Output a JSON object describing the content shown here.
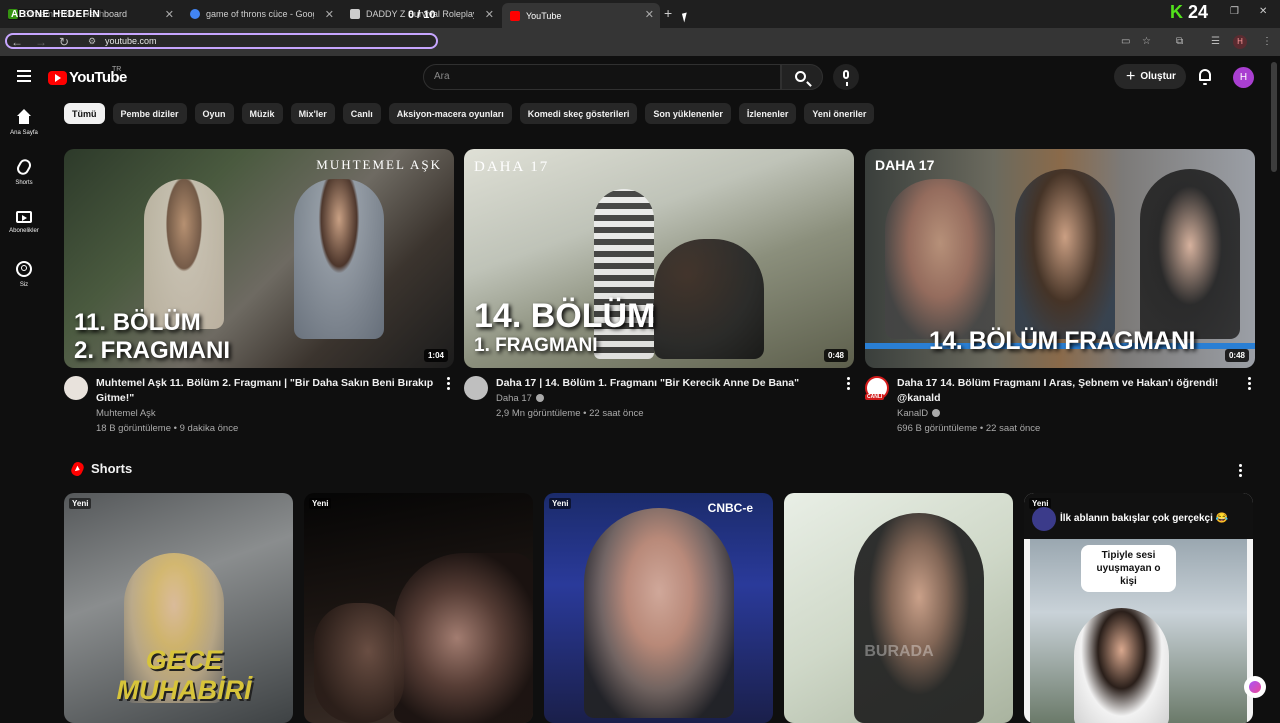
{
  "browser": {
    "tabs": [
      {
        "label": "Streamer Kick Dashboard",
        "fav_color": "#52e21b"
      },
      {
        "label": "game of throns cüce - Google'da Ara",
        "fav_color": "#4285f4"
      },
      {
        "label": "DADDY Z Survival Roleplay Ser",
        "fav_color": "#cccccc"
      },
      {
        "label": "YouTube",
        "fav_color": "#ff0000"
      }
    ],
    "new_tab_symbol": "+",
    "url": "youtube.com",
    "profile_letter": "H"
  },
  "overlay": {
    "abone_label": "ABONE HEDEFİN",
    "abone_count": "0 / 10",
    "kick_k": "K",
    "kick_num": "24"
  },
  "header": {
    "logo_text": "YouTube",
    "logo_region": "TR",
    "search_placeholder": "Ara",
    "create_label": "Oluştur",
    "avatar_letter": "H"
  },
  "sidebar": {
    "items": [
      {
        "label": "Ana Sayfa",
        "icon": "home-icon"
      },
      {
        "label": "Shorts",
        "icon": "shorts-icon"
      },
      {
        "label": "Abonelikler",
        "icon": "subscriptions-icon"
      },
      {
        "label": "Siz",
        "icon": "you-icon"
      }
    ]
  },
  "chips": [
    "Tümü",
    "Pembe diziler",
    "Oyun",
    "Müzik",
    "Mix'ler",
    "Canlı",
    "Aksiyon-macera oyunları",
    "Komedi skeç gösterileri",
    "Son yüklenenler",
    "İzlenenler",
    "Yeni öneriler"
  ],
  "videos": [
    {
      "thumb_line1": "11. BÖLÜM",
      "thumb_line2": "2. FRAGMANI",
      "thumb_brand": "MUHTEMEL AŞK",
      "duration": "1:04",
      "title": "Muhtemel Aşk 11. Bölüm 2. Fragmanı | \"Bir Daha Sakın Beni Bırakıp Gitme!\"",
      "channel": "Muhtemel Aşk",
      "views": "18 B görüntüleme",
      "age": "9 dakika önce"
    },
    {
      "thumb_line1": "14. BÖLÜM",
      "thumb_line2": "1. FRAGMANI",
      "thumb_brand": "DAHA 17",
      "duration": "0:48",
      "title": "Daha 17 | 14. Bölüm 1. Fragmanı \"Bir Kerecik Anne De Bana\"",
      "channel": "Daha 17",
      "views": "2,9 Mn görüntüleme",
      "age": "22 saat önce"
    },
    {
      "thumb_line1": "14. BÖLÜM FRAGMANI",
      "thumb_brand": "DAHA 17",
      "duration": "0:48",
      "title": "Daha 17 14. Bölüm Fragmanı I Aras, Şebnem ve Hakan'ı öğrendi! @kanald",
      "channel": "KanalD",
      "channel_badge": "CANLI",
      "views": "696 B görüntüleme",
      "age": "22 saat önce"
    }
  ],
  "shorts": {
    "heading": "Shorts",
    "items": [
      {
        "badge": "Yeni",
        "overlay_text": "GECE MUHABİRİ"
      },
      {
        "badge": "Yeni",
        "overlay_text": ""
      },
      {
        "badge": "Yeni",
        "overlay_text": "CNBC-e"
      },
      {
        "badge": "",
        "overlay_text": "BURADA"
      },
      {
        "badge": "Yeni",
        "overlay_text": "İlk ablanın bakışlar çok gerçekçi 😂",
        "bubble": "Tipiyle sesi uyuşmayan o kişi"
      }
    ]
  },
  "colors": {
    "background": "#0f0f0f",
    "accent_red": "#ff0000",
    "chip_bg": "#272727",
    "avatar": "#a93fd1"
  }
}
